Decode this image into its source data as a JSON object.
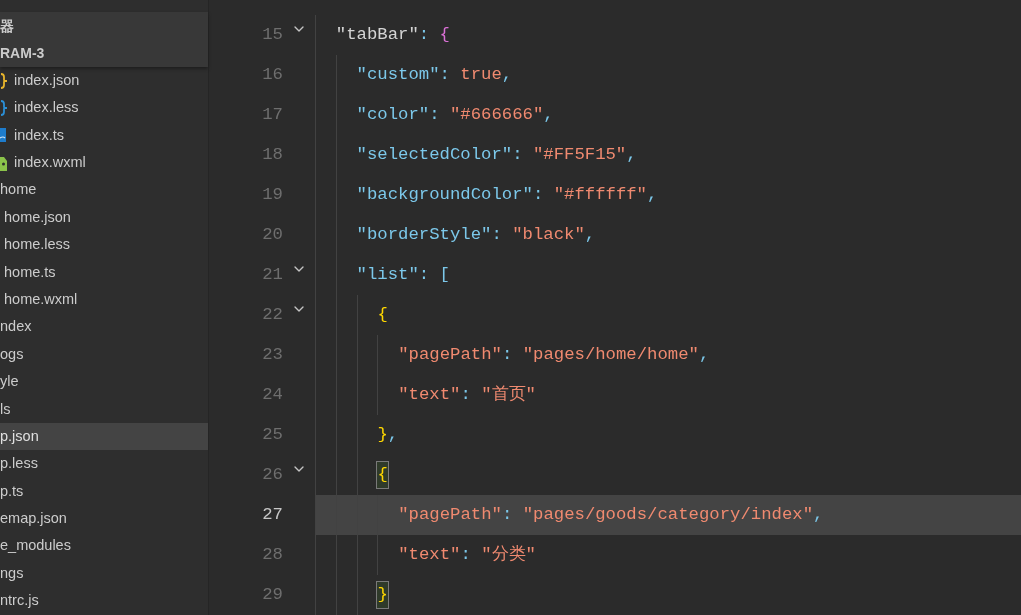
{
  "sidebar": {
    "title": "器",
    "project": "RAM-3",
    "items": [
      {
        "label": "index.json",
        "kind": "json",
        "selected": false
      },
      {
        "label": "index.less",
        "kind": "less",
        "selected": false
      },
      {
        "label": "index.ts",
        "kind": "ts",
        "selected": false
      },
      {
        "label": "index.wxml",
        "kind": "wxml",
        "selected": false
      },
      {
        "label": "home",
        "selected": false,
        "children": [
          {
            "label": "home.json",
            "selected": false
          },
          {
            "label": "home.less",
            "selected": false
          },
          {
            "label": "home.ts",
            "selected": false
          },
          {
            "label": "home.wxml",
            "selected": false
          }
        ]
      },
      {
        "label": "ndex",
        "selected": false
      },
      {
        "label": "ogs",
        "selected": false
      },
      {
        "label": "yle",
        "selected": false
      },
      {
        "label": "ls",
        "selected": false
      },
      {
        "label": "p.json",
        "selected": true
      },
      {
        "label": "p.less",
        "selected": false
      },
      {
        "label": "p.ts",
        "selected": false
      },
      {
        "label": "emap.json",
        "selected": false
      },
      {
        "label": "e_modules",
        "selected": false
      },
      {
        "label": "ngs",
        "selected": false
      },
      {
        "label": "ntrc.js",
        "selected": false
      }
    ]
  },
  "editor": {
    "lines": [
      {
        "number": "15",
        "foldable": true,
        "current": false,
        "tokens": [
          {
            "text": "\"tabBar\"",
            "kind": "key0"
          },
          {
            "text": ": ",
            "kind": "punct"
          },
          {
            "text": "{",
            "kind": "brace1",
            "matched": false
          }
        ],
        "children": [
          {
            "number": "16",
            "foldable": false,
            "current": false,
            "tokens": [
              {
                "text": "\"custom\"",
                "kind": "key1"
              },
              {
                "text": ": ",
                "kind": "punct"
              },
              {
                "text": "true",
                "kind": "string"
              },
              {
                "text": ",",
                "kind": "punct"
              }
            ]
          },
          {
            "number": "17",
            "foldable": false,
            "current": false,
            "tokens": [
              {
                "text": "\"color\"",
                "kind": "key1"
              },
              {
                "text": ": ",
                "kind": "punct"
              },
              {
                "text": "\"#666666\"",
                "kind": "string"
              },
              {
                "text": ",",
                "kind": "punct"
              }
            ]
          },
          {
            "number": "18",
            "foldable": false,
            "current": false,
            "tokens": [
              {
                "text": "\"selectedColor\"",
                "kind": "key1"
              },
              {
                "text": ": ",
                "kind": "punct"
              },
              {
                "text": "\"#FF5F15\"",
                "kind": "string"
              },
              {
                "text": ",",
                "kind": "punct"
              }
            ]
          },
          {
            "number": "19",
            "foldable": false,
            "current": false,
            "tokens": [
              {
                "text": "\"backgroundColor\"",
                "kind": "key1"
              },
              {
                "text": ": ",
                "kind": "punct"
              },
              {
                "text": "\"#ffffff\"",
                "kind": "string"
              },
              {
                "text": ",",
                "kind": "punct"
              }
            ]
          },
          {
            "number": "20",
            "foldable": false,
            "current": false,
            "tokens": [
              {
                "text": "\"borderStyle\"",
                "kind": "key1"
              },
              {
                "text": ": ",
                "kind": "punct"
              },
              {
                "text": "\"black\"",
                "kind": "string"
              },
              {
                "text": ",",
                "kind": "punct"
              }
            ]
          },
          {
            "number": "21",
            "foldable": true,
            "current": false,
            "tokens": [
              {
                "text": "\"list\"",
                "kind": "key1"
              },
              {
                "text": ": ",
                "kind": "punct"
              },
              {
                "text": "[",
                "kind": "brace2",
                "matched": false
              }
            ],
            "children": [
              {
                "number": "22",
                "foldable": true,
                "current": false,
                "tokens": [
                  {
                    "text": "{",
                    "kind": "brace3",
                    "matched": false
                  }
                ],
                "children": [
                  {
                    "number": "23",
                    "foldable": false,
                    "current": false,
                    "tokens": [
                      {
                        "text": "\"pagePath\"",
                        "kind": "string"
                      },
                      {
                        "text": ": ",
                        "kind": "punct"
                      },
                      {
                        "text": "\"pages/home/home\"",
                        "kind": "string"
                      },
                      {
                        "text": ",",
                        "kind": "punct"
                      }
                    ]
                  },
                  {
                    "number": "24",
                    "foldable": false,
                    "current": false,
                    "tokens": [
                      {
                        "text": "\"text\"",
                        "kind": "string"
                      },
                      {
                        "text": ": ",
                        "kind": "punct"
                      },
                      {
                        "text": "\"首页\"",
                        "kind": "string"
                      }
                    ]
                  }
                ]
              },
              {
                "number": "25",
                "foldable": false,
                "current": false,
                "tokens": [
                  {
                    "text": "}",
                    "kind": "brace3",
                    "matched": false
                  },
                  {
                    "text": ",",
                    "kind": "punct"
                  }
                ]
              },
              {
                "number": "26",
                "foldable": true,
                "current": false,
                "tokens": [
                  {
                    "text": "{",
                    "kind": "brace3",
                    "matched": true
                  }
                ],
                "children": [
                  {
                    "number": "27",
                    "foldable": false,
                    "current": true,
                    "tokens": [
                      {
                        "text": "\"pagePath\"",
                        "kind": "string"
                      },
                      {
                        "text": ": ",
                        "kind": "punct"
                      },
                      {
                        "text": "\"pages/goods/category/index\"",
                        "kind": "string"
                      },
                      {
                        "text": ",",
                        "kind": "punct"
                      }
                    ]
                  },
                  {
                    "number": "28",
                    "foldable": false,
                    "current": false,
                    "tokens": [
                      {
                        "text": "\"text\"",
                        "kind": "string"
                      },
                      {
                        "text": ": ",
                        "kind": "punct"
                      },
                      {
                        "text": "\"分类\"",
                        "kind": "string"
                      }
                    ]
                  }
                ]
              },
              {
                "number": "29",
                "foldable": false,
                "current": false,
                "tokens": [
                  {
                    "text": "}",
                    "kind": "brace3",
                    "matched": true
                  }
                ]
              }
            ]
          }
        ]
      }
    ]
  }
}
